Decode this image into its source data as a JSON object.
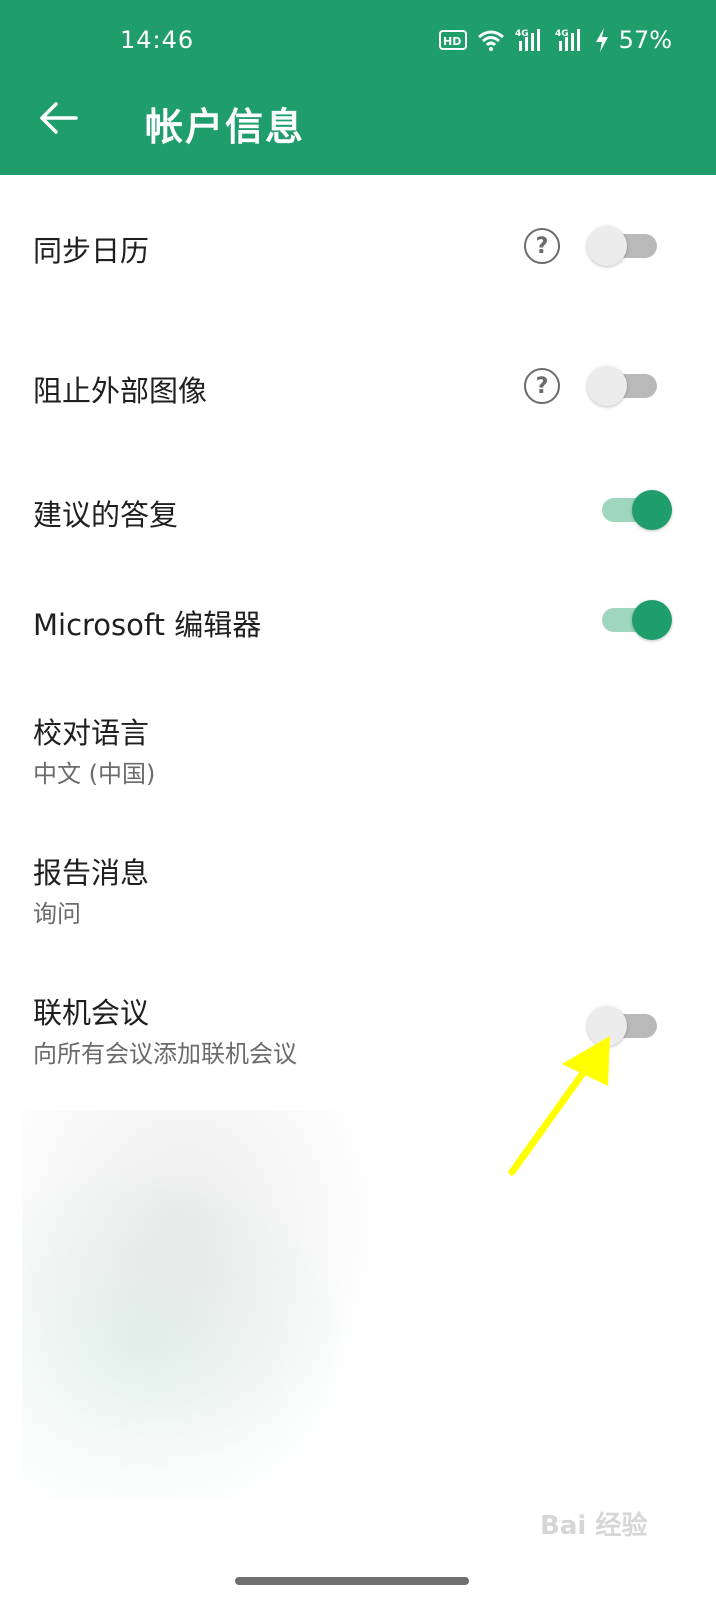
{
  "status_bar": {
    "time": "14:46",
    "battery": "57%",
    "icons": [
      "hd-icon",
      "wifi-icon",
      "signal-4g-icon",
      "signal-4g-icon",
      "charging-icon"
    ]
  },
  "header": {
    "title": "帐户信息",
    "back_icon": "arrow-left-icon",
    "background": "#1f9e6c"
  },
  "settings": {
    "sync_calendar": {
      "title": "同步日历",
      "enabled": false
    },
    "block_external_images": {
      "title": "阻止外部图像",
      "enabled": false
    },
    "suggested_replies": {
      "title": "建议的答复",
      "enabled": true
    },
    "microsoft_editor": {
      "title": "Microsoft 编辑器",
      "enabled": true
    },
    "proofing_language": {
      "title": "校对语言",
      "value": "中文 (中国)"
    },
    "report_message": {
      "title": "报告消息",
      "value": "询问"
    },
    "online_meeting": {
      "title": "联机会议",
      "subtitle": "向所有会议添加联机会议",
      "enabled": false
    }
  },
  "help_label": "?",
  "watermark": "Bai 经验",
  "annotation": {
    "arrow_color": "#ffff00"
  }
}
